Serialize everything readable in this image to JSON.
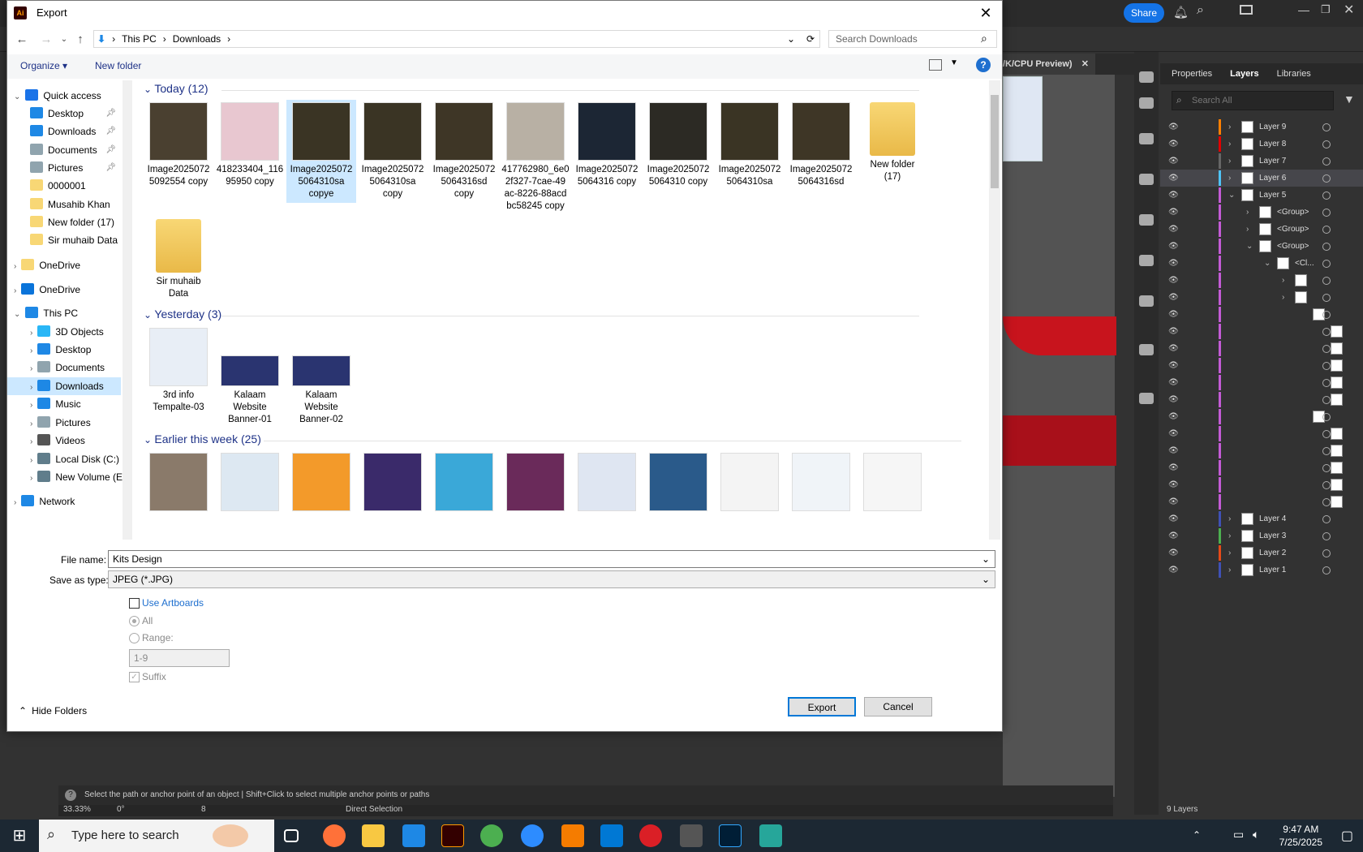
{
  "illustrator": {
    "share_label": "Share",
    "doc_tab_label": "/K/CPU Preview)",
    "panel_tabs": [
      "Properties",
      "Layers",
      "Libraries"
    ],
    "layer_search_placeholder": "Search All",
    "layers": [
      {
        "name": "Layer 9",
        "color": "#ff7f00",
        "indent": 0
      },
      {
        "name": "Layer 8",
        "color": "#e10000",
        "indent": 0
      },
      {
        "name": "Layer 7",
        "color": "#666666",
        "indent": 0
      },
      {
        "name": "Layer 6",
        "color": "#4fc3f7",
        "indent": 0,
        "selected": true
      },
      {
        "name": "Layer 5",
        "color": "#c45bd6",
        "indent": 0,
        "expanded": true
      },
      {
        "name": "<Group>",
        "color": "#c45bd6",
        "indent": 1
      },
      {
        "name": "<Group>",
        "color": "#c45bd6",
        "indent": 1
      },
      {
        "name": "<Group>",
        "color": "#c45bd6",
        "indent": 1,
        "expanded": true
      },
      {
        "name": "<Cl...",
        "color": "#c45bd6",
        "indent": 2,
        "expanded": true
      },
      {
        "name": "",
        "color": "#c45bd6",
        "indent": 3
      },
      {
        "name": "",
        "color": "#c45bd6",
        "indent": 3
      },
      {
        "name": "",
        "color": "#c45bd6",
        "indent": 4
      },
      {
        "name": "",
        "color": "#c45bd6",
        "indent": 5
      },
      {
        "name": "",
        "color": "#c45bd6",
        "indent": 5
      },
      {
        "name": "",
        "color": "#c45bd6",
        "indent": 5
      },
      {
        "name": "",
        "color": "#c45bd6",
        "indent": 5
      },
      {
        "name": "",
        "color": "#c45bd6",
        "indent": 5
      },
      {
        "name": "",
        "color": "#c45bd6",
        "indent": 4
      },
      {
        "name": "",
        "color": "#c45bd6",
        "indent": 5
      },
      {
        "name": "",
        "color": "#c45bd6",
        "indent": 5
      },
      {
        "name": "",
        "color": "#c45bd6",
        "indent": 5
      },
      {
        "name": "",
        "color": "#c45bd6",
        "indent": 5
      },
      {
        "name": "",
        "color": "#c45bd6",
        "indent": 5
      },
      {
        "name": "Layer 4",
        "color": "#3f51b5",
        "indent": 0
      },
      {
        "name": "Layer 3",
        "color": "#4caf50",
        "indent": 0
      },
      {
        "name": "Layer 2",
        "color": "#e64a19",
        "indent": 0
      },
      {
        "name": "Layer 1",
        "color": "#3f51b5",
        "indent": 0
      }
    ],
    "layers_count": "9 Layers",
    "status_text": "Select the path or anchor point of an object  |  Shift+Click to select multiple anchor points or paths",
    "zoom": "33.33%",
    "rotation": "0°",
    "artboard": "8",
    "tool_name": "Direct Selection"
  },
  "dialog": {
    "title": "Export",
    "breadcrumb": [
      "This PC",
      "Downloads"
    ],
    "search_placeholder": "Search Downloads",
    "organize_label": "Organize",
    "new_folder_label": "New folder",
    "sidebar": [
      {
        "label": "Quick access",
        "icon": "star-icon",
        "level": 0,
        "color": "#1a73e8"
      },
      {
        "label": "Desktop",
        "icon": "desktop-icon",
        "level": 1,
        "pinned": true,
        "color": "#1e88e5"
      },
      {
        "label": "Downloads",
        "icon": "download-icon",
        "level": 1,
        "pinned": true,
        "color": "#1e88e5"
      },
      {
        "label": "Documents",
        "icon": "document-icon",
        "level": 1,
        "pinned": true,
        "color": "#90a4ae"
      },
      {
        "label": "Pictures",
        "icon": "picture-icon",
        "level": 1,
        "pinned": true,
        "color": "#90a4ae"
      },
      {
        "label": "0000001",
        "icon": "folder-icon",
        "level": 1,
        "color": "#f8d775"
      },
      {
        "label": "Musahib Khan",
        "icon": "folder-icon",
        "level": 1,
        "color": "#f8d775"
      },
      {
        "label": "New folder (17)",
        "icon": "folder-icon",
        "level": 1,
        "color": "#f8d775"
      },
      {
        "label": "Sir muhaib Data",
        "icon": "folder-icon",
        "level": 1,
        "color": "#f8d775"
      },
      {
        "label": "OneDrive",
        "icon": "folder-icon",
        "level": 0,
        "color": "#f8d775"
      },
      {
        "label": "OneDrive",
        "icon": "cloud-icon",
        "level": 0,
        "color": "#0a74da"
      },
      {
        "label": "This PC",
        "icon": "pc-icon",
        "level": 0,
        "color": "#1e88e5"
      },
      {
        "label": "3D Objects",
        "icon": "cube-icon",
        "level": 1,
        "color": "#29b6f6"
      },
      {
        "label": "Desktop",
        "icon": "desktop-icon",
        "level": 1,
        "color": "#1e88e5"
      },
      {
        "label": "Documents",
        "icon": "document-icon",
        "level": 1,
        "color": "#90a4ae"
      },
      {
        "label": "Downloads",
        "icon": "download-icon",
        "level": 1,
        "selected": true,
        "color": "#1e88e5"
      },
      {
        "label": "Music",
        "icon": "music-icon",
        "level": 1,
        "color": "#1e88e5"
      },
      {
        "label": "Pictures",
        "icon": "picture-icon",
        "level": 1,
        "color": "#90a4ae"
      },
      {
        "label": "Videos",
        "icon": "video-icon",
        "level": 1,
        "color": "#555555"
      },
      {
        "label": "Local Disk (C:)",
        "icon": "disk-icon",
        "level": 1,
        "color": "#607d8b"
      },
      {
        "label": "New Volume (E:)",
        "icon": "disk-icon",
        "level": 1,
        "color": "#607d8b"
      },
      {
        "label": "Network",
        "icon": "network-icon",
        "level": 0,
        "color": "#1e88e5"
      }
    ],
    "groups": [
      {
        "header": "Today (12)",
        "items": [
          {
            "name": "Image2025072\n5092554 copy",
            "thumb": "#4a4030"
          },
          {
            "name": "418233404_116\n95950 copy",
            "thumb": "#e8c7d0"
          },
          {
            "name": "Image2025072\n5064310sa\ncopye",
            "thumb": "#3a3424",
            "selected": true
          },
          {
            "name": "Image2025072\n5064310sa\ncopy",
            "thumb": "#3a3424"
          },
          {
            "name": "Image2025072\n5064316sd\ncopy",
            "thumb": "#3e3626"
          },
          {
            "name": "417762980_6e0\n2f327-7cae-49\nac-8226-88acd\nbc58245 copy",
            "thumb": "#b8b0a4"
          },
          {
            "name": "Image2025072\n5064316 copy",
            "thumb": "#1c2634"
          },
          {
            "name": "Image2025072\n5064310 copy",
            "thumb": "#2c2a24"
          },
          {
            "name": "Image2025072\n5064310sa",
            "thumb": "#3a3424"
          },
          {
            "name": "Image2025072\n5064316sd",
            "thumb": "#3e3626"
          },
          {
            "name": "New folder\n(17)",
            "thumb": "folder"
          },
          {
            "name": "Sir muhaib\nData",
            "thumb": "folder"
          }
        ]
      },
      {
        "header": "Yesterday (3)",
        "items": [
          {
            "name": "3rd info\nTempalte-03",
            "thumb": "#e8eef6"
          },
          {
            "name": "Kalaam\nWebsite\nBanner-01",
            "thumb": "#2a3470"
          },
          {
            "name": "Kalaam\nWebsite\nBanner-02",
            "thumb": "#2a3470"
          }
        ]
      },
      {
        "header": "Earlier this week (25)",
        "items": [
          {
            "name": "",
            "thumb": "#8a7a6a"
          },
          {
            "name": "",
            "thumb": "#dde8f2"
          },
          {
            "name": "",
            "thumb": "#f39a2a"
          },
          {
            "name": "",
            "thumb": "#3a2a6a"
          },
          {
            "name": "",
            "thumb": "#3aa8d8"
          },
          {
            "name": "",
            "thumb": "#6a2a5a"
          },
          {
            "name": "",
            "thumb": "#dfe6f2"
          },
          {
            "name": "",
            "thumb": "#2a5a8a"
          },
          {
            "name": "",
            "thumb": "#f4f4f4"
          },
          {
            "name": "",
            "thumb": "#f0f4f8"
          },
          {
            "name": "",
            "thumb": "#f6f6f6"
          }
        ]
      }
    ],
    "file_name_label": "File name:",
    "file_name_value": "Kits Design",
    "save_type_label": "Save as type:",
    "save_type_value": "JPEG (*.JPG)",
    "use_artboards_label": "Use Artboards",
    "all_label": "All",
    "range_label": "Range:",
    "range_value": "1-9",
    "suffix_label": "Suffix",
    "hide_folders_label": "Hide Folders",
    "export_label": "Export",
    "cancel_label": "Cancel"
  },
  "taskbar": {
    "search_placeholder": "Type here to search",
    "time": "9:47 AM",
    "date": "7/25/2025"
  }
}
